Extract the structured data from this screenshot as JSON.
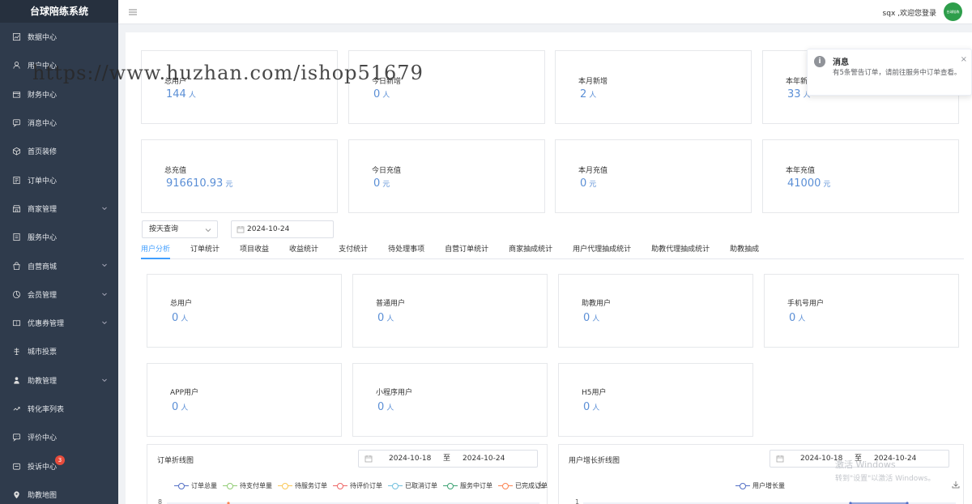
{
  "app": {
    "title": "台球陪练系统"
  },
  "sidebar": {
    "items": [
      {
        "label": "数据中心",
        "icon": "chart-icon",
        "expand": false
      },
      {
        "label": "用户中心",
        "icon": "user-icon",
        "expand": false
      },
      {
        "label": "财务中心",
        "icon": "wallet-icon",
        "expand": false
      },
      {
        "label": "消息中心",
        "icon": "message-icon",
        "expand": false
      },
      {
        "label": "首页装修",
        "icon": "box-icon",
        "expand": false
      },
      {
        "label": "订单中心",
        "icon": "order-icon",
        "expand": false
      },
      {
        "label": "商家管理",
        "icon": "merchant-icon",
        "expand": true
      },
      {
        "label": "服务中心",
        "icon": "service-icon",
        "expand": false
      },
      {
        "label": "自营商城",
        "icon": "shop-icon",
        "expand": true
      },
      {
        "label": "会员管理",
        "icon": "member-icon",
        "expand": true
      },
      {
        "label": "优惠券管理",
        "icon": "coupon-icon",
        "expand": true
      },
      {
        "label": "城市投票",
        "icon": "vote-icon",
        "expand": false
      },
      {
        "label": "助教管理",
        "icon": "coach-icon",
        "expand": true
      },
      {
        "label": "转化率列表",
        "icon": "conversion-icon",
        "expand": false
      },
      {
        "label": "评价中心",
        "icon": "comment-icon",
        "expand": false
      },
      {
        "label": "投诉中心",
        "icon": "complaint-icon",
        "expand": false,
        "badge": "3"
      },
      {
        "label": "助教地图",
        "icon": "map-pin-icon",
        "expand": false
      }
    ]
  },
  "header": {
    "welcome": "sqx ,欢迎您登录",
    "avatar_text": "台球陪练"
  },
  "stats_row1": [
    {
      "label": "总用户",
      "value": "144",
      "unit": "人"
    },
    {
      "label": "今日新增",
      "value": "0",
      "unit": "人"
    },
    {
      "label": "本月新增",
      "value": "2",
      "unit": "人"
    },
    {
      "label": "本年新增",
      "value": "33",
      "unit": "人"
    }
  ],
  "stats_row2": [
    {
      "label": "总充值",
      "value": "916610.93",
      "unit": "元"
    },
    {
      "label": "今日充值",
      "value": "0",
      "unit": "元"
    },
    {
      "label": "本月充值",
      "value": "0",
      "unit": "元"
    },
    {
      "label": "本年充值",
      "value": "41000",
      "unit": "元"
    }
  ],
  "filter": {
    "query_mode": "按天查询",
    "date": "2024-10-24"
  },
  "tabs": [
    "用户分析",
    "订单统计",
    "项目收益",
    "收益统计",
    "支付统计",
    "待处理事项",
    "自营订单统计",
    "商家抽成统计",
    "用户代理抽成统计",
    "助教代理抽成统计",
    "助教抽成"
  ],
  "user_stats": [
    {
      "label": "总用户",
      "value": "0",
      "unit": "人"
    },
    {
      "label": "普通用户",
      "value": "0",
      "unit": "人"
    },
    {
      "label": "助教用户",
      "value": "0",
      "unit": "人"
    },
    {
      "label": "手机号用户",
      "value": "0",
      "unit": "人"
    },
    {
      "label": "APP用户",
      "value": "0",
      "unit": "人"
    },
    {
      "label": "小程序用户",
      "value": "0",
      "unit": "人"
    },
    {
      "label": "H5用户",
      "value": "0",
      "unit": "人"
    }
  ],
  "order_chart": {
    "title": "订单折线图",
    "start": "2024-10-18",
    "sep": "至",
    "end": "2024-10-24",
    "legend": [
      {
        "name": "订单总量",
        "color": "#5470c6"
      },
      {
        "name": "待支付单量",
        "color": "#91cc75"
      },
      {
        "name": "待服务订单",
        "color": "#fac858"
      },
      {
        "name": "待评价订单",
        "color": "#ee6666"
      },
      {
        "name": "已取消订单",
        "color": "#73c0de"
      },
      {
        "name": "服务中订单",
        "color": "#3ba272"
      },
      {
        "name": "已完成订单",
        "color": "#fc8452"
      }
    ],
    "y_top": "8"
  },
  "user_chart": {
    "title": "用户增长折线图",
    "start": "2024-10-18",
    "sep": "至",
    "end": "2024-10-24",
    "legend": [
      {
        "name": "用户增长量",
        "color": "#5470c6"
      }
    ],
    "y_top": "1"
  },
  "notice": {
    "title": "消息",
    "body": "有5条警告订单，请前往服务中订单查看。"
  },
  "watermark": "https://www.huzhan.com/ishop51679",
  "windows_activation": {
    "line1": "激活 Windows",
    "line2": "转到\"设置\"以激活 Windows。"
  }
}
